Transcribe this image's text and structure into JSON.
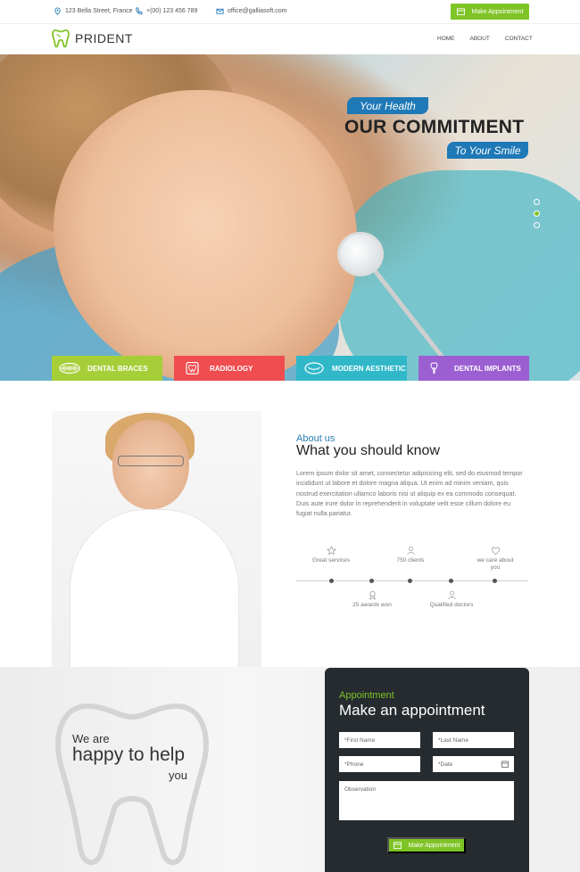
{
  "topbar": {
    "address": "123 Bella Street, France",
    "phone": "+(00) 123 456 789",
    "email": "office@galliasoft.com",
    "appointment_button": "Make Appointment"
  },
  "nav": {
    "logo": "PRIDENT",
    "links": [
      "HOME",
      "ABOUT",
      "CONTACT"
    ]
  },
  "hero": {
    "tag_top": "Your Health",
    "headline": "OUR COMMITMENT",
    "tag_bottom": "To Your Smile",
    "slides": 3,
    "active_slide": 2
  },
  "services": [
    {
      "label": "DENTAL BRACES",
      "color": "#a6ce39"
    },
    {
      "label": "RADIOLOGY",
      "color": "#ef4d50"
    },
    {
      "label": "MODERN AESTHETIC",
      "color": "#30b8c9"
    },
    {
      "label": "DENTAL IMPLANTS",
      "color": "#9b5fd1"
    }
  ],
  "about": {
    "kicker": "About us",
    "title": "What you should know",
    "text": "Lorem ipsum dolor sit amet, consectetur adipisicing elit, sed do eiusmod tempor incididunt ut labore et dolore magna aliqua. Ut enim ad minim veniam, quis nostrud exercitation ullamco laboris nisi ut aliquip ex ea commodo consequat. Duis aute irure dolor in reprehenderit in voluptate velit esse cillum dolore eu fugiat nulla pariatur.",
    "timeline": {
      "top": [
        "Great services",
        "750 clients",
        "we care about you"
      ],
      "bottom": [
        "25 awards won",
        "Qualified doctors"
      ]
    }
  },
  "help": {
    "line1": "We are",
    "line2": "happy to help",
    "line3": "you"
  },
  "appointment": {
    "kicker": "Appointment",
    "title": "Make an appointment",
    "first_name": "First Name",
    "last_name": "Last Name",
    "phone": "Phone",
    "date": "Date",
    "observation": "Observation",
    "button": "Make Appointment"
  }
}
